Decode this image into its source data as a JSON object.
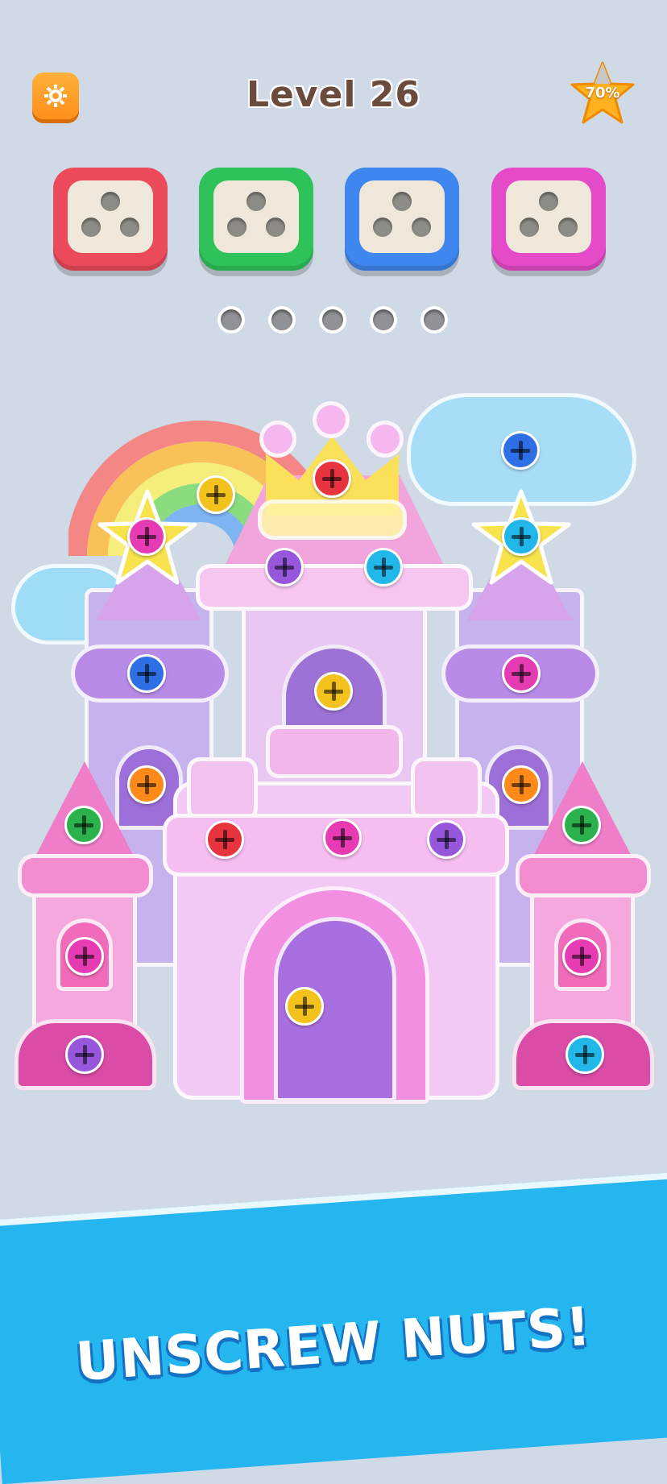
{
  "header": {
    "title": "Level 26",
    "progress_label": "70%",
    "progress_fraction": 0.7
  },
  "boxes": [
    {
      "color": "#ea4a5a",
      "name": "red"
    },
    {
      "color": "#2fc25a",
      "name": "green"
    },
    {
      "color": "#3f86ee",
      "name": "blue"
    },
    {
      "color": "#e54bc8",
      "name": "pink"
    }
  ],
  "slots_count": 5,
  "screw_colors": {
    "red": "#e8343f",
    "yellow": "#f4c21c",
    "purple": "#9757dd",
    "blue": "#2f6fe6",
    "cyan": "#21b7e9",
    "pink": "#e63bb2",
    "orange": "#ff8a1a",
    "green": "#2bb24c"
  },
  "banner": {
    "text": "UNSCREW NUTS!"
  },
  "icons": {
    "settings": "gear-icon",
    "progress": "star-icon",
    "screw": "screw-icon"
  }
}
